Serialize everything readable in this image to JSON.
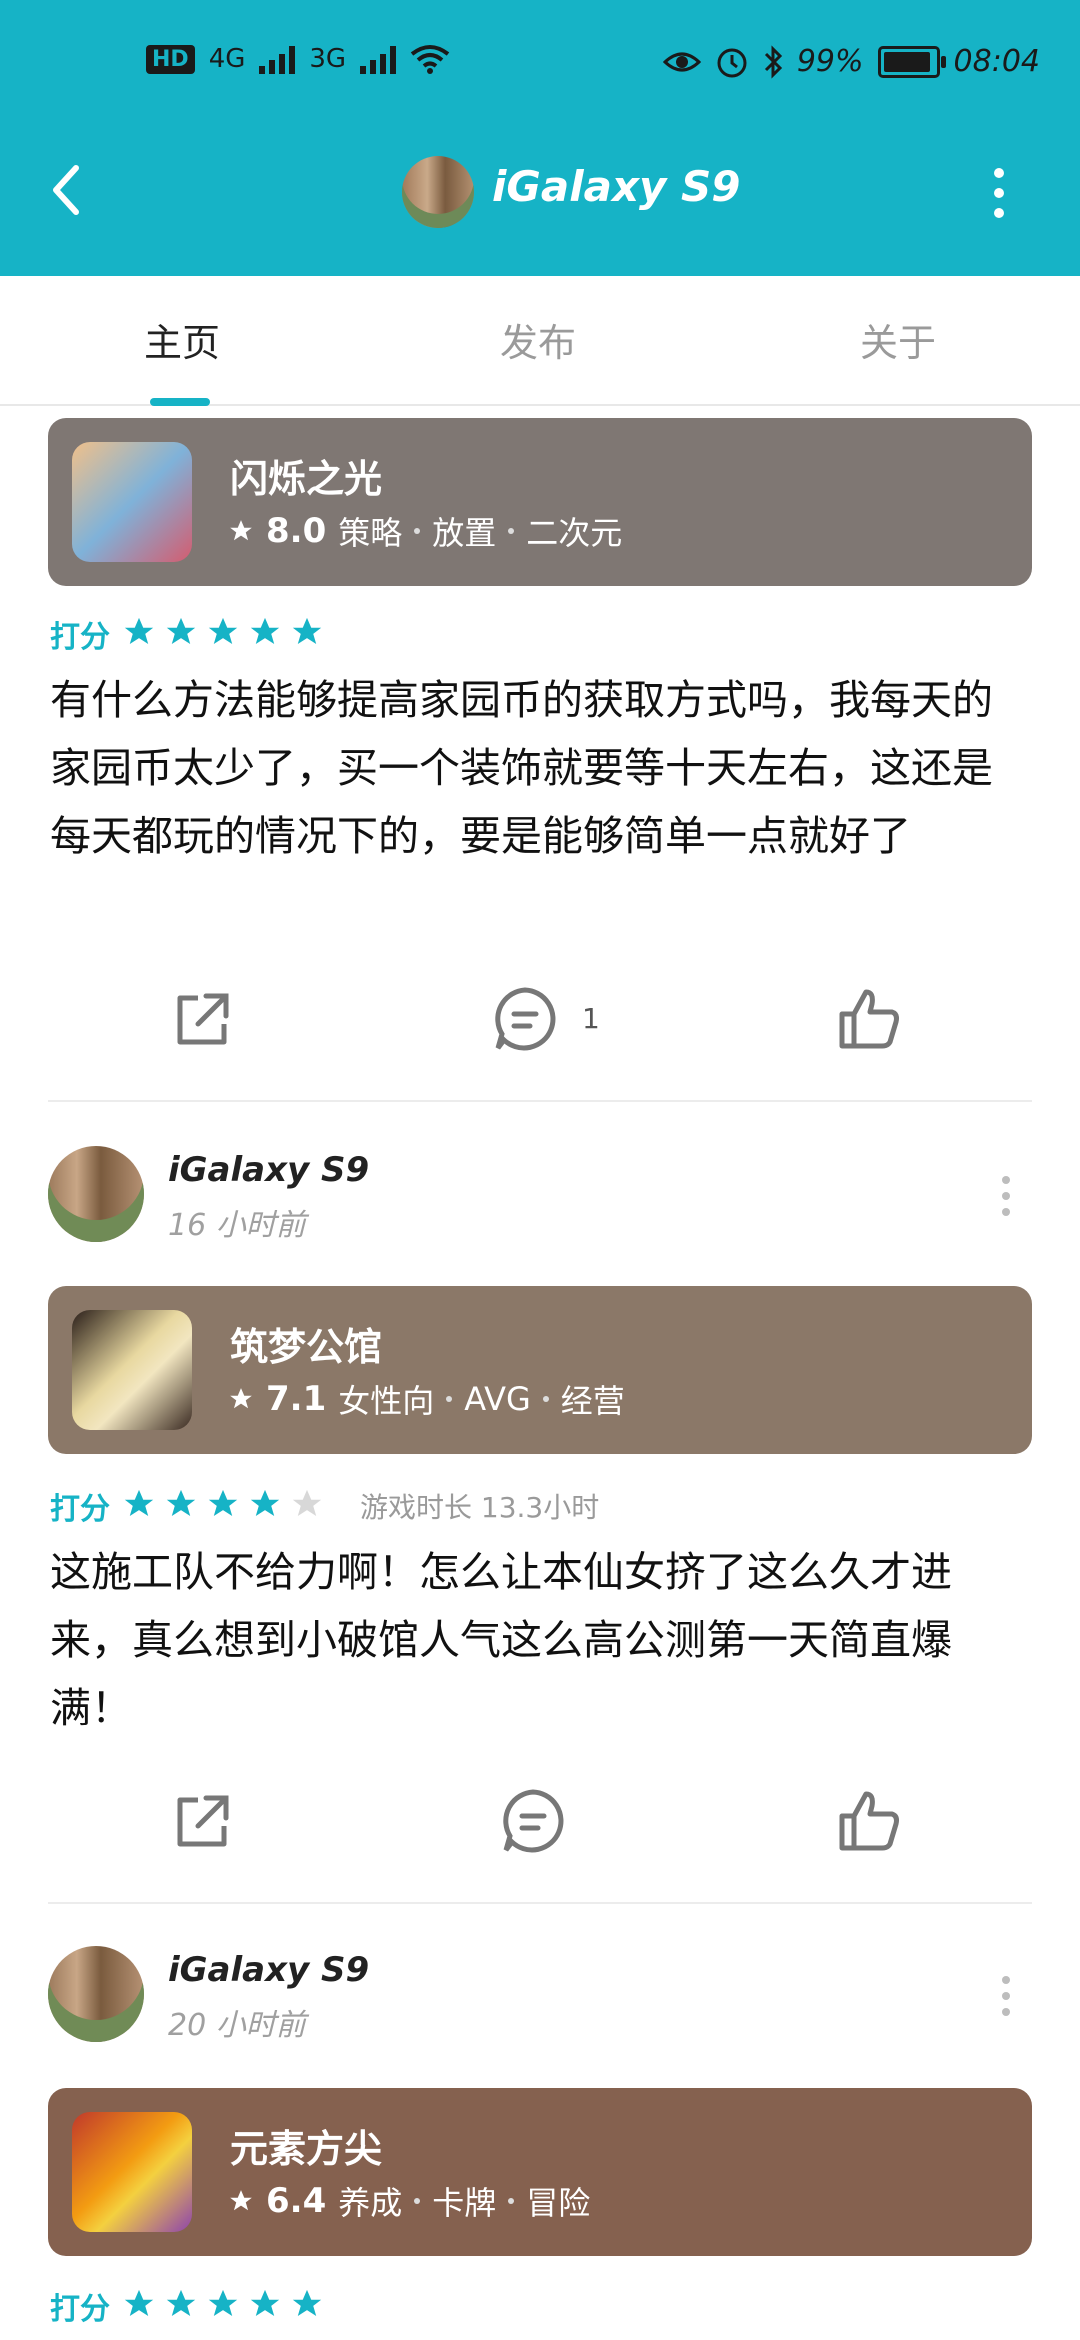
{
  "status_bar": {
    "hd": "HD",
    "net1": "4G",
    "net2": "3G",
    "battery": "99%",
    "time": "08:04"
  },
  "header": {
    "title": "iGalaxy S9"
  },
  "tabs": [
    {
      "label": "主页",
      "active": true
    },
    {
      "label": "发布",
      "active": false
    },
    {
      "label": "关于",
      "active": false
    }
  ],
  "posts": [
    {
      "game": {
        "name": "闪烁之光",
        "score": "8.0",
        "tags": [
          "策略",
          "放置",
          "二次元"
        ],
        "card_color": "#7f7773"
      },
      "rating_label": "打分",
      "stars": 5,
      "review": "有什么方法能够提高家园币的获取方式吗，我每天的家园币太少了，买一个装饰就要等十天左右，这还是每天都玩的情况下的，要是能够简单一点就好了",
      "comment_count": "1"
    },
    {
      "user": {
        "name": "iGalaxy S9",
        "time": "16 小时前"
      },
      "game": {
        "name": "筑梦公馆",
        "score": "7.1",
        "tags": [
          "女性向",
          "AVG",
          "经营"
        ],
        "card_color": "#8b7868"
      },
      "rating_label": "打分",
      "stars": 4,
      "playtime": "游戏时长 13.3小时",
      "review": "这施工队不给力啊！怎么让本仙女挤了这么久才进来，真么想到小破馆人气这么高公测第一天简直爆满！",
      "comment_count": ""
    },
    {
      "user": {
        "name": "iGalaxy S9",
        "time": "20 小时前"
      },
      "game": {
        "name": "元素方尖",
        "score": "6.4",
        "tags": [
          "养成",
          "卡牌",
          "冒险"
        ],
        "card_color": "#85614f"
      },
      "rating_label": "打分",
      "stars": 5
    }
  ],
  "colors": {
    "accent": "#16b3c6",
    "star_empty": "#d8d8d8"
  }
}
